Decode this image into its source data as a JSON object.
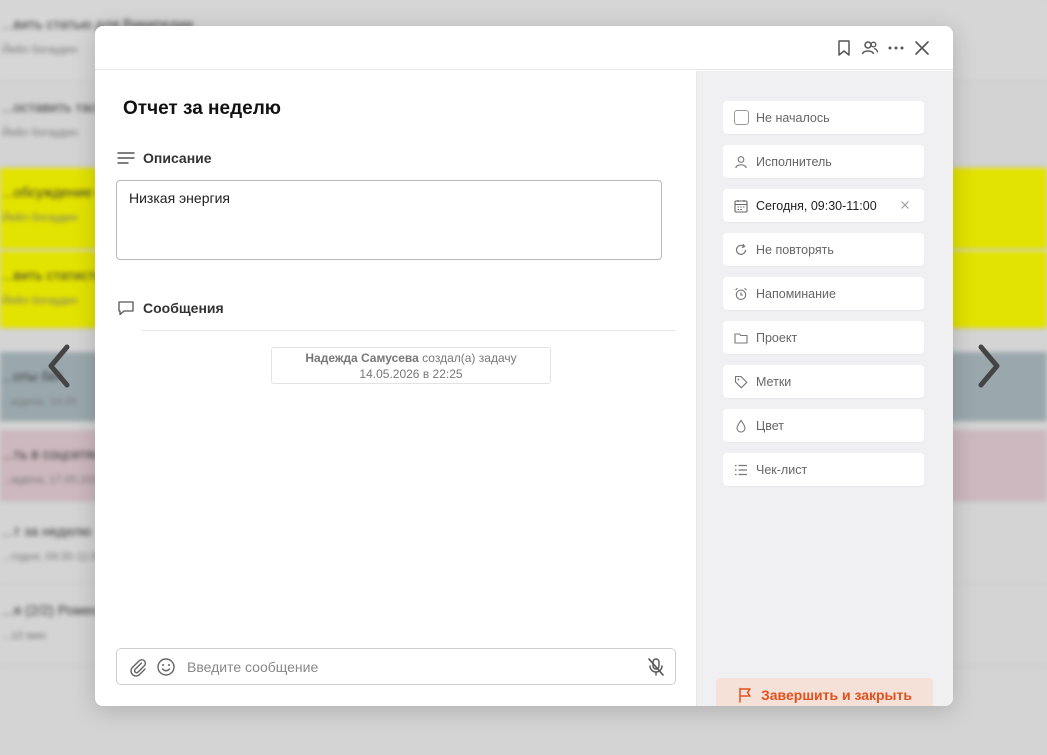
{
  "background_list": [
    {
      "title": "...вить статью для Википедии",
      "subtitle": "Йейл богаудин",
      "color": "#d6d6d6"
    },
    {
      "title": "...оставить таск...",
      "subtitle": "Йейл богаудин",
      "color": "#d3d3d3"
    },
    {
      "title": "...обсуждение на...",
      "subtitle": "Йейл богаудин",
      "color": "#e3e300"
    },
    {
      "title": "...вить статистик...",
      "subtitle": "Йейл богаудин",
      "color": "#e3e300"
    },
    {
      "title": "...оты бег",
      "subtitle": "...ждена, 14.05",
      "color": "#9aa8ad"
    },
    {
      "title": "...ть в соцсетях",
      "subtitle": "...ждена, 17.05.2026",
      "color": "#ccb8be"
    },
    {
      "title": "...т за неделю",
      "subtitle": "...годня, 09:30-11:00",
      "color": "#d4d4d4"
    },
    {
      "title": "...я (2/2) Ромео",
      "subtitle": "...10 мин",
      "color": "#d4d4d4"
    }
  ],
  "header_icons": [
    "bookmark-icon",
    "participants-icon",
    "more-icon",
    "close-icon"
  ],
  "task": {
    "title": "Отчет за неделю",
    "description_label": "Описание",
    "description_value": "Низкая энергия",
    "messages_label": "Сообщения"
  },
  "history": {
    "author": "Надежда Самусева",
    "action": "создал(а) задачу",
    "timestamp": "14.05.2026 в 22:25"
  },
  "composer": {
    "placeholder": "Введите сообщение"
  },
  "properties": {
    "status": "Не началось",
    "assignee": "Исполнитель",
    "date": "Сегодня, 09:30-11:00",
    "repeat": "Не повторять",
    "reminder": "Напоминание",
    "project": "Проект",
    "tags": "Метки",
    "color": "Цвет",
    "checklist": "Чек-лист"
  },
  "finish_button": "Завершить и закрыть",
  "colors": {
    "accent": "#e0521d",
    "accent_bg": "#f6e1d8",
    "sidebar_bg": "#f0f0f2"
  }
}
